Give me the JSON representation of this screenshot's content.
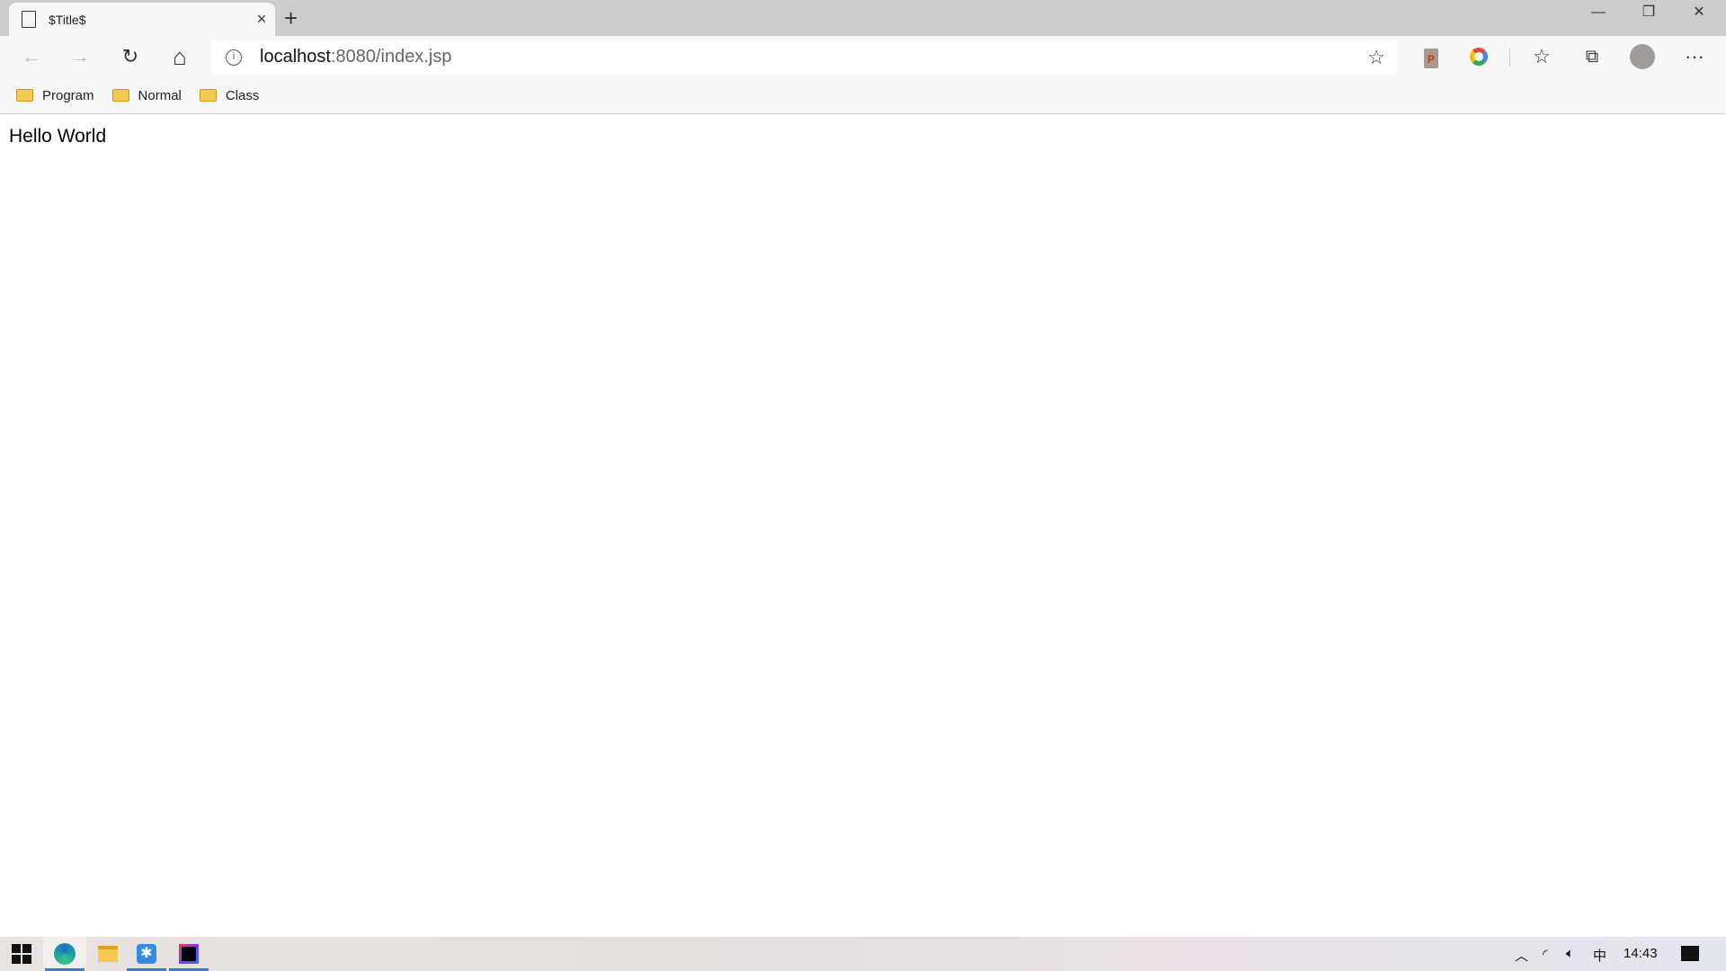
{
  "tab": {
    "title": "$Title$",
    "close": "×",
    "new_tab": "+"
  },
  "window": {
    "minimize": "—",
    "maximize": "❐",
    "close": "✕"
  },
  "toolbar": {
    "back": "←",
    "forward": "→",
    "refresh": "↻",
    "home": "⌂",
    "url_host": "localhost",
    "url_rest": ":8080/index.jsp",
    "favorite": "☆",
    "extension_p": "P",
    "more": "···"
  },
  "bookmarks": [
    {
      "label": "Program"
    },
    {
      "label": "Normal"
    },
    {
      "label": "Class"
    }
  ],
  "page": {
    "text": "Hello World"
  },
  "taskbar": {
    "time": "14:43",
    "ime": "中"
  }
}
